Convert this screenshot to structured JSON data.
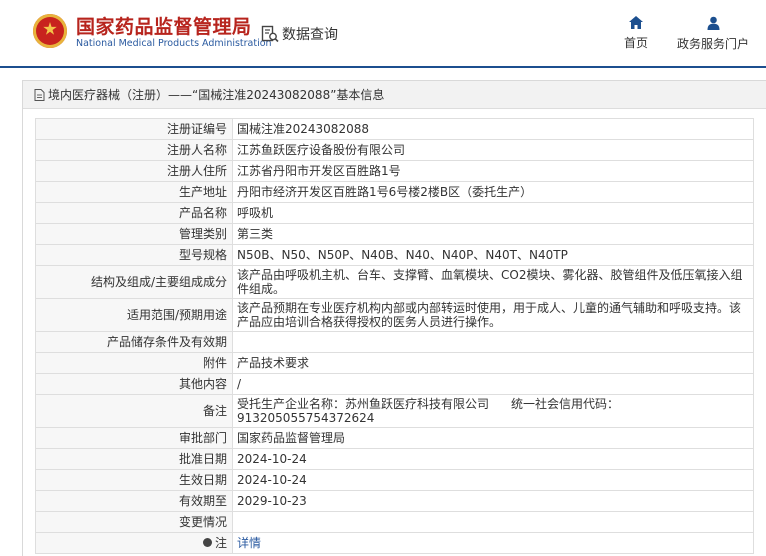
{
  "header": {
    "site_name_cn": "国家药品监督管理局",
    "site_name_en": "National Medical Products Administration",
    "query_label": "数据查询",
    "nav_home": "首页",
    "nav_portal": "政务服务门户"
  },
  "panel": {
    "breadcrumb": "境内医疗器械（注册）——“国械注准20243082088”基本信息"
  },
  "rows": [
    {
      "label": "注册证编号",
      "value": "国械注准20243082088"
    },
    {
      "label": "注册人名称",
      "value": "江苏鱼跃医疗设备股份有限公司"
    },
    {
      "label": "注册人住所",
      "value": "江苏省丹阳市开发区百胜路1号"
    },
    {
      "label": "生产地址",
      "value": "丹阳市经济开发区百胜路1号6号楼2楼B区（委托生产）"
    },
    {
      "label": "产品名称",
      "value": "呼吸机"
    },
    {
      "label": "管理类别",
      "value": "第三类"
    },
    {
      "label": "型号规格",
      "value": "N50B、N50、N50P、N40B、N40、N40P、N40T、N40TP"
    },
    {
      "label": "结构及组成/主要组成成分",
      "value": "该产品由呼吸机主机、台车、支撑臂、血氧模块、CO2模块、雾化器、胶管组件及低压氧接入组件组成。"
    },
    {
      "label": "适用范围/预期用途",
      "value": "该产品预期在专业医疗机构内部或内部转运时使用，用于成人、儿童的通气辅助和呼吸支持。该产品应由培训合格获得授权的医务人员进行操作。"
    },
    {
      "label": "产品储存条件及有效期",
      "value": ""
    },
    {
      "label": "附件",
      "value": "产品技术要求"
    },
    {
      "label": "其他内容",
      "value": "/"
    },
    {
      "label": "备注",
      "value": "受托生产企业名称：苏州鱼跃医疗科技有限公司",
      "value2": "统一社会信用代码：913205055754372624"
    },
    {
      "label": "审批部门",
      "value": "国家药品监督管理局"
    },
    {
      "label": "批准日期",
      "value": "2024-10-24"
    },
    {
      "label": "生效日期",
      "value": "2024-10-24"
    },
    {
      "label": "有效期至",
      "value": "2029-10-23"
    },
    {
      "label": "变更情况",
      "value": ""
    },
    {
      "label": "注",
      "value": "详情"
    }
  ]
}
